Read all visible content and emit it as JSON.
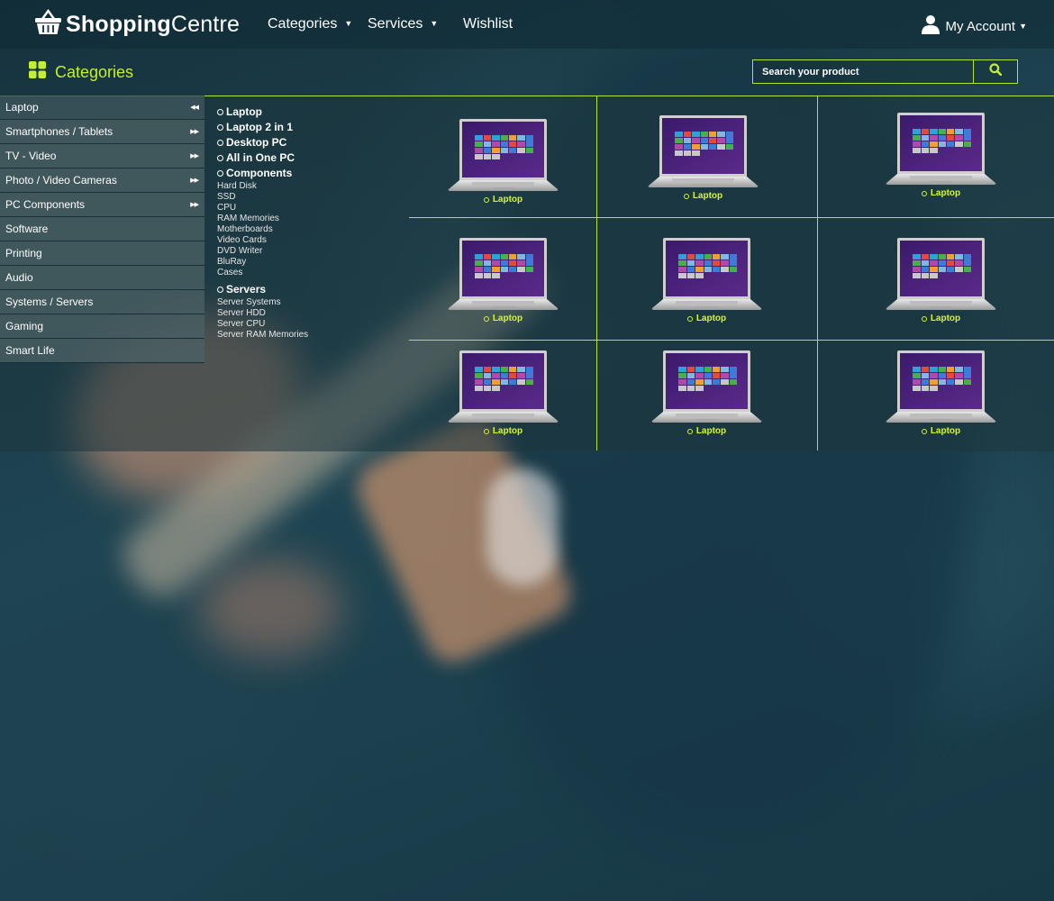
{
  "header": {
    "brand_bold": "Shopping",
    "brand_light": "Centre",
    "logo_icon": "basket-icon",
    "nav": [
      {
        "label": "Categories",
        "has_caret": true
      },
      {
        "label": "Services",
        "has_caret": true
      },
      {
        "label": "Wishlist",
        "has_caret": false
      }
    ],
    "account_label": "My Account",
    "account_icon": "user-icon"
  },
  "categories_heading": "Categories",
  "search": {
    "placeholder": "Search your product",
    "icon": "search-icon"
  },
  "colors": {
    "accent": "#c4ef2e",
    "grid_line": "#b6e234",
    "sidebar_bg": "#4a6064"
  },
  "sidebar": {
    "items": [
      {
        "label": "Laptop",
        "arrows": "◀◀"
      },
      {
        "label": "Smartphones / Tablets",
        "arrows": "▶▶"
      },
      {
        "label": "TV - Video",
        "arrows": "▶▶"
      },
      {
        "label": "Photo / Video Cameras",
        "arrows": "▶▶"
      },
      {
        "label": "PC Components",
        "arrows": "▶▶"
      },
      {
        "label": "Software",
        "arrows": ""
      },
      {
        "label": "Printing",
        "arrows": ""
      },
      {
        "label": "Audio",
        "arrows": ""
      },
      {
        "label": "Systems / Servers",
        "arrows": ""
      },
      {
        "label": "Gaming",
        "arrows": ""
      },
      {
        "label": "Smart Life",
        "arrows": ""
      }
    ]
  },
  "submenu": {
    "headings": [
      "Laptop",
      "Laptop 2 in 1",
      "Desktop PC",
      "All in One PC",
      "Components",
      "Servers"
    ],
    "components": [
      "Hard Disk",
      "SSD",
      "CPU",
      "RAM Memories",
      "Motherboards",
      "Video Cards",
      "DVD Writer",
      "BluRay",
      "Cases"
    ],
    "servers": [
      "Server Systems",
      "Server HDD",
      "Server CPU",
      "Server RAM Memories"
    ]
  },
  "products": [
    {
      "label": "Laptop"
    },
    {
      "label": "Laptop"
    },
    {
      "label": "Laptop"
    },
    {
      "label": "Laptop"
    },
    {
      "label": "Laptop"
    },
    {
      "label": "Laptop"
    },
    {
      "label": "Laptop"
    },
    {
      "label": "Laptop"
    },
    {
      "label": "Laptop"
    }
  ]
}
